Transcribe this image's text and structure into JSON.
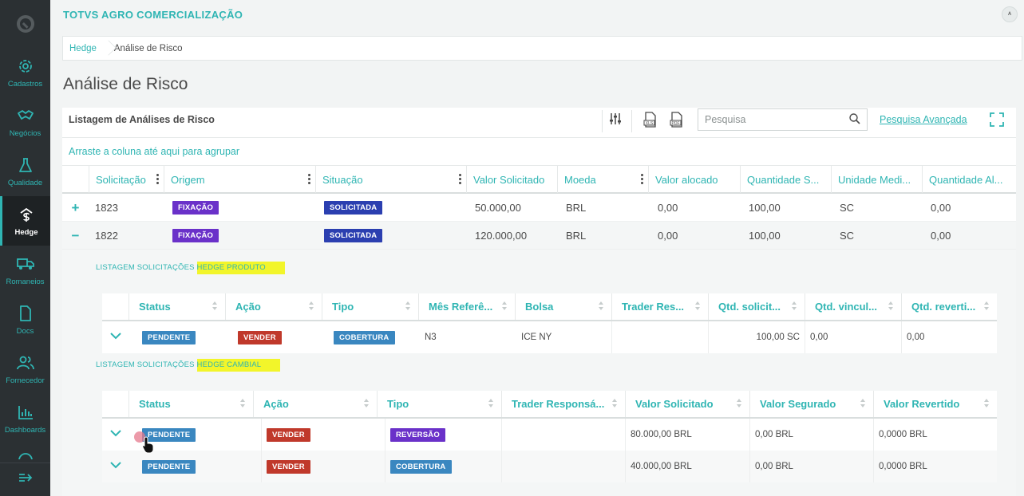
{
  "app": {
    "title": "TOTVS AGRO COMERCIALIZAÇÃO",
    "user_icon": "user-icon"
  },
  "sidebar": {
    "items": [
      {
        "label": "Cadastros",
        "icon": "gear-icon"
      },
      {
        "label": "Negócios",
        "icon": "handshake-icon"
      },
      {
        "label": "Qualidade",
        "icon": "flask-icon"
      },
      {
        "label": "Hedge",
        "icon": "hedge-icon",
        "active": true
      },
      {
        "label": "Romaneios",
        "icon": "truck-icon"
      },
      {
        "label": "Docs",
        "icon": "document-icon"
      },
      {
        "label": "Fornecedor",
        "icon": "users-icon"
      },
      {
        "label": "Dashboards",
        "icon": "bar-chart-icon"
      }
    ],
    "collapse_icon": "collapse-arrow-icon"
  },
  "breadcrumb": {
    "items": [
      "Hedge",
      "Análise de Risco"
    ]
  },
  "page": {
    "title": "Análise de Risco"
  },
  "panel": {
    "title": "Listagem de Análises de Risco",
    "search_placeholder": "Pesquisa",
    "advanced_search": "Pesquisa Avançada",
    "group_hint": "Arraste a coluna até aqui para agrupar"
  },
  "grid": {
    "columns": [
      "Solicitação",
      "Origem",
      "Situação",
      "Valor Solicitado",
      "Moeda",
      "Valor alocado",
      "Quantidade S...",
      "Unidade Medi...",
      "Quantidade Al..."
    ],
    "rows": [
      {
        "expander": "+",
        "solicitacao": "1823",
        "origem": "FIXAÇÃO",
        "situacao": "SOLICITADA",
        "valor_solicitado": "50.000,00",
        "moeda": "BRL",
        "valor_alocado": "0,00",
        "quantidade_s": "100,00",
        "unidade": "SC",
        "quantidade_al": "0,00"
      },
      {
        "expander": "−",
        "solicitacao": "1822",
        "origem": "FIXAÇÃO",
        "situacao": "SOLICITADA",
        "valor_solicitado": "120.000,00",
        "moeda": "BRL",
        "valor_alocado": "0,00",
        "quantidade_s": "100,00",
        "unidade": "SC",
        "quantidade_al": "0,00"
      }
    ]
  },
  "detail": {
    "produto": {
      "title_prefix": "LISTAGEM SOLICITAÇÕES",
      "title_highlight": "HEDGE PRODUTO",
      "columns": [
        "Status",
        "Ação",
        "Tipo",
        "Mês Referê...",
        "Bolsa",
        "Trader Res...",
        "Qtd. solicit...",
        "Qtd. vincul...",
        "Qtd. reverti..."
      ],
      "rows": [
        {
          "status": "PENDENTE",
          "acao": "VENDER",
          "tipo": "COBERTURA",
          "mes": "N3",
          "bolsa": "ICE NY",
          "trader": "",
          "qtd_solicit": "100,00 SC",
          "qtd_vincul": "0,00",
          "qtd_reverti": "0,00"
        }
      ]
    },
    "cambial": {
      "title_prefix": "LISTAGEM SOLICITAÇÕES",
      "title_highlight": "HEDGE CAMBIAL",
      "columns": [
        "Status",
        "Ação",
        "Tipo",
        "Trader Responsá...",
        "Valor Solicitado",
        "Valor Segurado",
        "Valor Revertido"
      ],
      "rows": [
        {
          "status": "PENDENTE",
          "acao": "VENDER",
          "tipo": "REVERSÃO",
          "trader": "",
          "valor_solicitado": "80.000,00 BRL",
          "valor_segurado": "0,00 BRL",
          "valor_revertido": "0,0000 BRL"
        },
        {
          "status": "PENDENTE",
          "acao": "VENDER",
          "tipo": "COBERTURA",
          "trader": "",
          "valor_solicitado": "40.000,00 BRL",
          "valor_segurado": "0,00 BRL",
          "valor_revertido": "0,0000 BRL"
        }
      ]
    }
  },
  "colors": {
    "accent": "#2fb5b3",
    "sidebar_bg": "#2b3033",
    "tag_purple": "#6a31c9",
    "tag_navy": "#2b3fb0",
    "tag_blue": "#3a87c0",
    "tag_red": "#c0392b",
    "highlight": "#f2f52a"
  }
}
